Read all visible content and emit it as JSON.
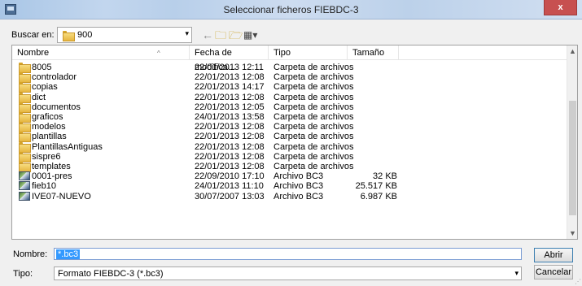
{
  "window": {
    "title": "Seleccionar ficheros FIEBDC-3",
    "close_label": "x"
  },
  "lookin": {
    "label": "Buscar en:",
    "value": "900"
  },
  "icons": {
    "dropdown": "▾",
    "back": "←",
    "up": "🗀",
    "new_folder": "🗁",
    "views": "▦▾",
    "sort_up": "^",
    "scroll_up": "▲",
    "scroll_down": "▼",
    "grip": "⋰"
  },
  "columns": {
    "name": "Nombre",
    "date": "Fecha de modifica...",
    "type": "Tipo",
    "size": "Tamaño"
  },
  "files": [
    {
      "name": "8005",
      "date": "22/01/2013 12:11",
      "type": "Carpeta de archivos",
      "size": "",
      "icon": "folder-icon"
    },
    {
      "name": "controlador",
      "date": "22/01/2013 12:08",
      "type": "Carpeta de archivos",
      "size": "",
      "icon": "folder-icon"
    },
    {
      "name": "copias",
      "date": "22/01/2013 14:17",
      "type": "Carpeta de archivos",
      "size": "",
      "icon": "folder-icon"
    },
    {
      "name": "dict",
      "date": "22/01/2013 12:08",
      "type": "Carpeta de archivos",
      "size": "",
      "icon": "folder-icon"
    },
    {
      "name": "documentos",
      "date": "22/01/2013 12:05",
      "type": "Carpeta de archivos",
      "size": "",
      "icon": "folder-icon"
    },
    {
      "name": "graficos",
      "date": "24/01/2013 13:58",
      "type": "Carpeta de archivos",
      "size": "",
      "icon": "folder-icon"
    },
    {
      "name": "modelos",
      "date": "22/01/2013 12:08",
      "type": "Carpeta de archivos",
      "size": "",
      "icon": "folder-icon"
    },
    {
      "name": "plantillas",
      "date": "22/01/2013 12:08",
      "type": "Carpeta de archivos",
      "size": "",
      "icon": "folder-icon"
    },
    {
      "name": "PlantillasAntiguas",
      "date": "22/01/2013 12:08",
      "type": "Carpeta de archivos",
      "size": "",
      "icon": "folder-icon"
    },
    {
      "name": "sispre6",
      "date": "22/01/2013 12:08",
      "type": "Carpeta de archivos",
      "size": "",
      "icon": "folder-icon"
    },
    {
      "name": "templates",
      "date": "22/01/2013 12:08",
      "type": "Carpeta de archivos",
      "size": "",
      "icon": "folder-icon"
    },
    {
      "name": "0001-pres",
      "date": "22/09/2010 17:10",
      "type": "Archivo BC3",
      "size": "32 KB",
      "icon": "bc3-file-icon"
    },
    {
      "name": "fieb10",
      "date": "24/01/2013 11:10",
      "type": "Archivo BC3",
      "size": "25.517 KB",
      "icon": "bc3-file-icon"
    },
    {
      "name": "IVE07-NUEVO",
      "date": "30/07/2007 13:03",
      "type": "Archivo BC3",
      "size": "6.987 KB",
      "icon": "bc3-file-icon"
    }
  ],
  "filename": {
    "label": "Nombre:",
    "value": "*.bc3"
  },
  "filetype": {
    "label": "Tipo:",
    "value": "Formato FIEBDC-3 (*.bc3)"
  },
  "buttons": {
    "open": "Abrir",
    "cancel": "Cancelar"
  }
}
